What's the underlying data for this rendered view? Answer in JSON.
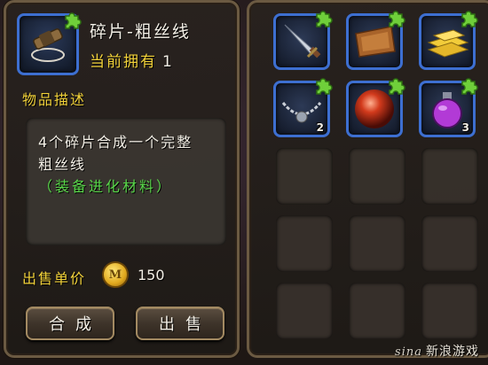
{
  "detail": {
    "title": "碎片-粗丝线",
    "owned_label": "当前拥有",
    "owned_count": "1",
    "desc_heading": "物品描述",
    "desc_line1": "4个碎片合成一个完整",
    "desc_line2": "粗丝线",
    "desc_note": "（装备进化材料）",
    "price_label": "出售单价",
    "coin_letter": "M",
    "price_value": "150",
    "combine_button": "合成",
    "sell_button": "出售"
  },
  "inventory": {
    "items": [
      {
        "name": "dagger-fragment",
        "qty": ""
      },
      {
        "name": "leather-fragment",
        "qty": ""
      },
      {
        "name": "gold-bars-fragment",
        "qty": ""
      },
      {
        "name": "chain-necklace-fragment",
        "qty": "2"
      },
      {
        "name": "red-orb-fragment",
        "qty": ""
      },
      {
        "name": "purple-potion-fragment",
        "qty": "3"
      }
    ]
  },
  "watermark": {
    "logo": "sina",
    "text": "新浪游戏"
  },
  "colors": {
    "accent_yellow": "#f2d23a",
    "accent_green": "#59d64a",
    "slot_border_blue": "#3d6fd1"
  }
}
